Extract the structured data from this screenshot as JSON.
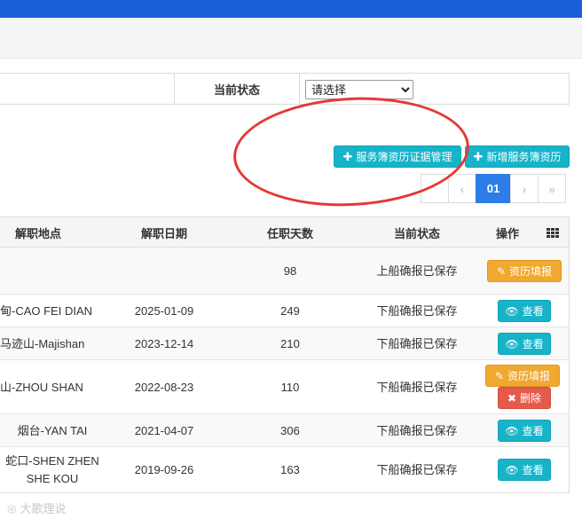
{
  "filter": {
    "status_label": "当前状态",
    "status_select": "请选择"
  },
  "toolbar": {
    "cert_manage_label": "服务簿资历证据管理",
    "add_record_label": "新增服务簿资历"
  },
  "pagination": {
    "prev_first": "‹",
    "current": "01",
    "next": "›",
    "last": "»"
  },
  "table": {
    "headers": {
      "location": "解职地点",
      "date": "解职日期",
      "days": "任职天数",
      "status": "当前状态",
      "actions": "操作"
    },
    "rows": [
      {
        "location": "",
        "date": "",
        "days": "98",
        "status": "上船确报已保存",
        "action1": "资历填报"
      },
      {
        "location": "甸-CAO FEI DIAN",
        "date": "2025-01-09",
        "days": "249",
        "status": "下船确报已保存",
        "action1": "查看"
      },
      {
        "location": "马迹山-Majishan",
        "date": "2023-12-14",
        "days": "210",
        "status": "下船确报已保存",
        "action1": "查看"
      },
      {
        "location": "山-ZHOU SHAN",
        "date": "2022-08-23",
        "days": "110",
        "status": "下船确报已保存",
        "action1": "资历填报",
        "action2": "删除"
      },
      {
        "location": "烟台-YAN TAI",
        "date": "2021-04-07",
        "days": "306",
        "status": "下船确报已保存",
        "action1": "查看"
      },
      {
        "location": "蛇口-SHEN ZHEN SHE KOU",
        "date": "2019-09-26",
        "days": "163",
        "status": "下船确报已保存",
        "action1": "查看"
      }
    ]
  },
  "watermark": "大歌理说",
  "colors": {
    "topbar": "#1a5fd6",
    "info": "#17b4c9",
    "warning": "#f0a830",
    "danger": "#e55a4a",
    "pager_active": "#2d7de8",
    "annotation": "#e53935"
  }
}
